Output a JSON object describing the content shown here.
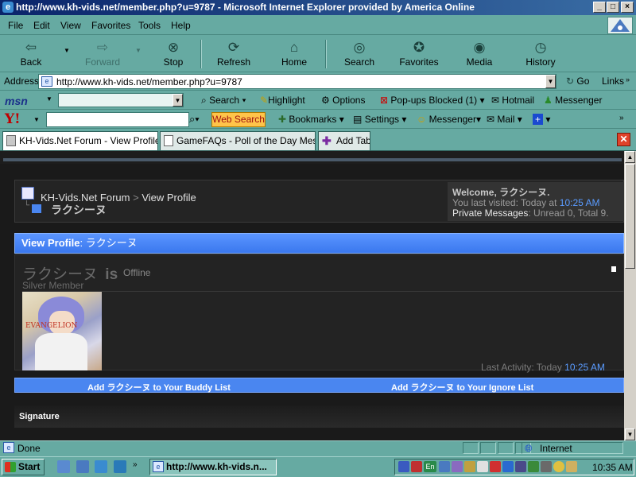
{
  "window": {
    "title": "http://www.kh-vids.net/member.php?u=9787 - Microsoft Internet Explorer provided by America Online",
    "icon": "ie-icon"
  },
  "menu": [
    "File",
    "Edit",
    "View",
    "Favorites",
    "Tools",
    "Help"
  ],
  "toolbar": {
    "back": "Back",
    "forward": "Forward",
    "stop": "Stop",
    "refresh": "Refresh",
    "home": "Home",
    "search": "Search",
    "favorites": "Favorites",
    "media": "Media",
    "history": "History"
  },
  "address": {
    "label": "Address",
    "url": "http://www.kh-vids.net/member.php?u=9787",
    "go": "Go",
    "links": "Links"
  },
  "msn": {
    "logo": "msn",
    "search": "Search",
    "highlight": "Highlight",
    "options": "Options",
    "popups": "Pop-ups Blocked (1)",
    "hotmail": "Hotmail",
    "messenger": "Messenger"
  },
  "yahoo": {
    "logo": "Y!",
    "web_search": "Web Search",
    "bookmarks": "Bookmarks",
    "settings": "Settings",
    "messenger": "Messenger",
    "mail": "Mail"
  },
  "tabs": [
    {
      "label": "KH-Vids.Net Forum - View Profile: ?",
      "active": true
    },
    {
      "label": "GameFAQs - Poll of the Day Message",
      "active": false
    }
  ],
  "add_tab": "Add Tab",
  "page": {
    "breadcrumb_site": "KH-Vids.Net Forum",
    "breadcrumb_sep": ">",
    "breadcrumb_page": "View Profile",
    "breadcrumb_user": "ラクシーヌ",
    "welcome_prefix": "Welcome, ",
    "welcome_user": "ラクシーヌ.",
    "last_visited_label": "You last visited: Today at ",
    "last_visited_time": "10:25 AM",
    "pm_label": "Private Messages",
    "pm_text": ": Unread 0, Total 9.",
    "view_profile_label": "View Profile",
    "view_profile_user": ": ラクシーヌ",
    "username": "ラクシーヌ",
    "is_word": "is",
    "status": "Offline",
    "rank": "Silver Member",
    "last_activity_label": "Last Activity: Today ",
    "last_activity_time": "10:25 AM",
    "add_buddy": "Add ラクシーヌ to Your Buddy List",
    "add_ignore": "Add ラクシーヌ to Your Ignore List",
    "signature_header": "Signature",
    "avatar_text": "EVANGELION"
  },
  "status": {
    "text": "Done",
    "zone": "Internet"
  },
  "taskbar": {
    "start": "Start",
    "task": "http://www.kh-vids.n...",
    "clock": "10:35 AM",
    "lang": "En"
  },
  "colors": {
    "chrome": "#66aaa2",
    "accent_blue": "#4a86f0",
    "title_blue": "#0a246a"
  }
}
